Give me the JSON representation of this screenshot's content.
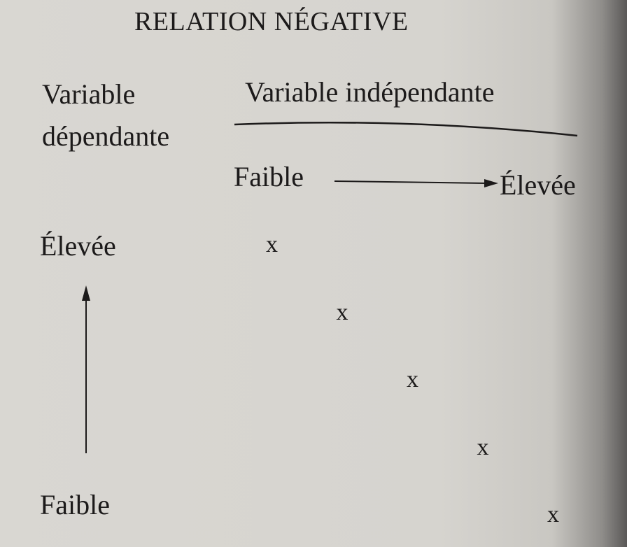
{
  "title": "RELATION NÉGATIVE",
  "y_axis": {
    "label_line1": "Variable",
    "label_line2": "dépendante",
    "high": "Élevée",
    "low": "Faible"
  },
  "x_axis": {
    "label": "Variable indépendante",
    "low": "Faible",
    "high": "Élevée"
  },
  "marker": "x",
  "points": [
    {
      "x": 1,
      "y": 5
    },
    {
      "x": 2,
      "y": 4
    },
    {
      "x": 3,
      "y": 3
    },
    {
      "x": 4,
      "y": 2
    },
    {
      "x": 5,
      "y": 1
    }
  ]
}
